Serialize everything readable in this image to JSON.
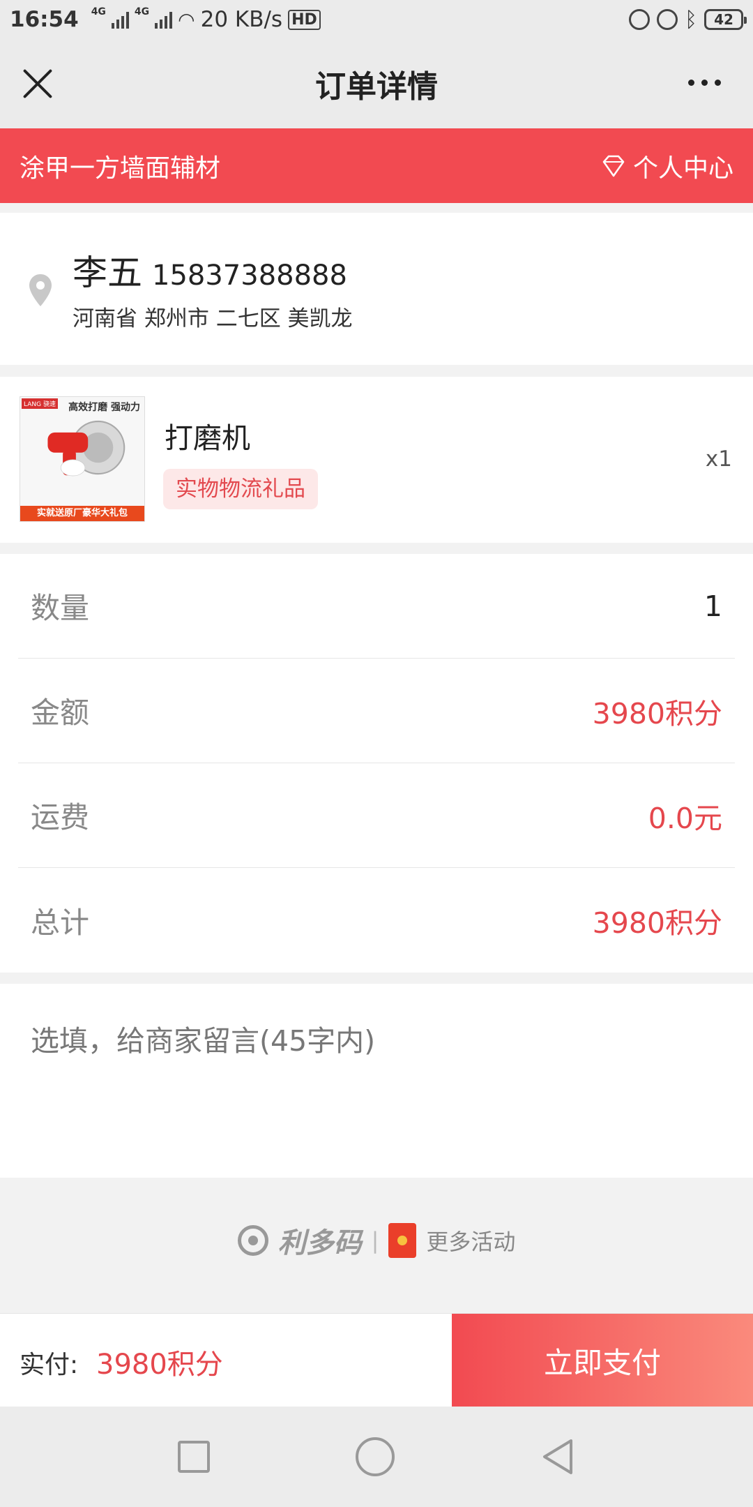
{
  "status": {
    "time": "16:54",
    "signal_label": "4G",
    "speed": "20 KB/s",
    "hd": "HD",
    "battery": "42"
  },
  "header": {
    "title": "订单详情"
  },
  "shop": {
    "name": "涂甲一方墙面辅材",
    "center_label": "个人中心"
  },
  "address": {
    "name": "李五",
    "phone": "15837388888",
    "full": "河南省 郑州市 二七区 美凯龙"
  },
  "product": {
    "name": "打磨机",
    "tag": "实物物流礼品",
    "qty": "x1",
    "thumb_caption": "高效打磨 强动力",
    "thumb_logo": "LANG 骁速",
    "thumb_banner": "实就送原厂豪华大礼包"
  },
  "summary": {
    "rows": [
      {
        "label": "数量",
        "value": "1"
      },
      {
        "label": "金额",
        "value": "3980积分"
      },
      {
        "label": "运费",
        "value": "0.0元"
      },
      {
        "label": "总计",
        "value": "3980积分"
      }
    ]
  },
  "remark": {
    "placeholder": "选填，给商家留言(45字内)"
  },
  "brand": {
    "name": "利多码",
    "sep": "|",
    "more": "更多活动"
  },
  "pay": {
    "label": "实付:",
    "amount": "3980积分",
    "button": "立即支付"
  },
  "colors": {
    "accent": "#f24a51",
    "price": "#e5474d"
  }
}
